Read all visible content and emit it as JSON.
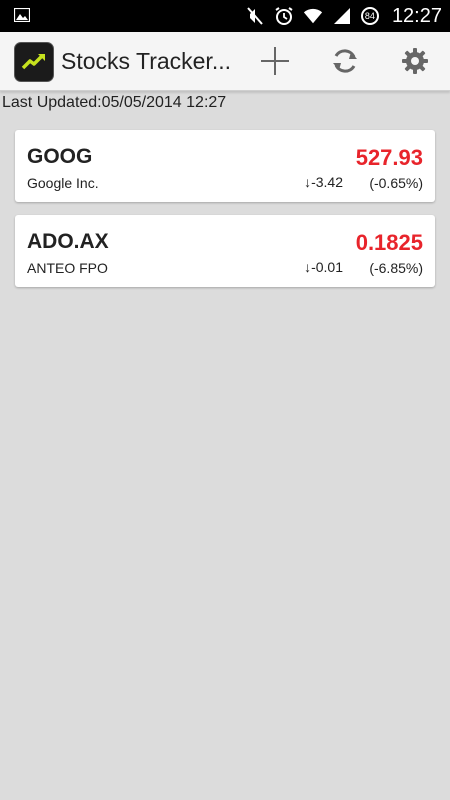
{
  "status_bar": {
    "time": "12:27",
    "battery_level": "84",
    "icons": [
      "image-icon",
      "mute-icon",
      "alarm-icon",
      "wifi-icon",
      "signal-icon",
      "battery-icon"
    ]
  },
  "action_bar": {
    "title": "Stocks Tracker...",
    "app_icon": "stock-chart-icon",
    "actions": [
      "add-icon",
      "refresh-icon",
      "settings-icon"
    ]
  },
  "last_updated": "Last Updated:05/05/2014 12:27",
  "colors": {
    "price_down": "#e8242b",
    "background": "#dcdcdc",
    "app_icon_line": "#c6e21e"
  },
  "stocks": [
    {
      "symbol": "GOOG",
      "name": "Google Inc.",
      "price": "527.93",
      "change": "↓-3.42",
      "change_percent": "(-0.65%)"
    },
    {
      "symbol": "ADO.AX",
      "name": "ANTEO FPO",
      "price": "0.1825",
      "change": "↓-0.01",
      "change_percent": "(-6.85%)"
    }
  ]
}
